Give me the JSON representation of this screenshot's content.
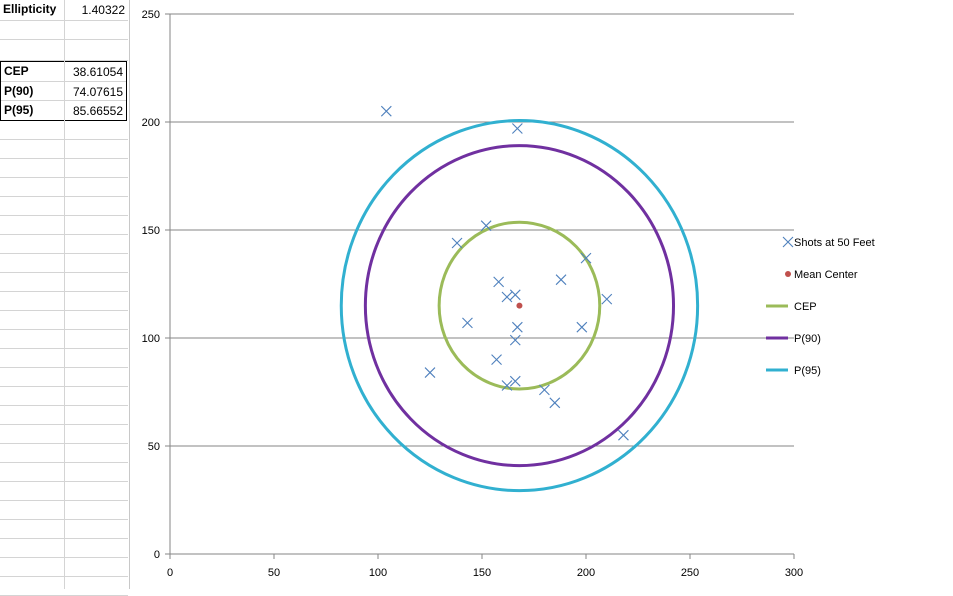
{
  "sheet": {
    "ellipticity": {
      "label": "Ellipticity",
      "value": "1.40322"
    },
    "rows": [
      {
        "label": "CEP",
        "value": "38.61054"
      },
      {
        "label": "P(90)",
        "value": "74.07615"
      },
      {
        "label": "P(95)",
        "value": "85.66552"
      }
    ]
  },
  "chart_data": {
    "type": "scatter",
    "xlim": [
      0,
      300
    ],
    "ylim": [
      0,
      250
    ],
    "x_ticks": [
      "0",
      "50",
      "100",
      "150",
      "200",
      "250",
      "300"
    ],
    "y_ticks": [
      "0",
      "50",
      "100",
      "150",
      "200",
      "250"
    ],
    "grid": "horizontal",
    "legend_position": "right",
    "series": [
      {
        "name": "Shots at 50 Feet",
        "marker": "x",
        "color": "#4f81bd",
        "points": [
          [
            104,
            205
          ],
          [
            167,
            197
          ],
          [
            152,
            152
          ],
          [
            138,
            144
          ],
          [
            200,
            137
          ],
          [
            188,
            127
          ],
          [
            158,
            126
          ],
          [
            166,
            120
          ],
          [
            162,
            119
          ],
          [
            210,
            118
          ],
          [
            143,
            107
          ],
          [
            167,
            105
          ],
          [
            198,
            105
          ],
          [
            166,
            99
          ],
          [
            157,
            90
          ],
          [
            125,
            84
          ],
          [
            166,
            80
          ],
          [
            162,
            78
          ],
          [
            180,
            76
          ],
          [
            185,
            70
          ],
          [
            218,
            55
          ]
        ]
      },
      {
        "name": "Mean Center",
        "marker": "dot",
        "color": "#c0504d",
        "points": [
          [
            168,
            115
          ]
        ]
      },
      {
        "name": "CEP",
        "type": "circle",
        "color": "#9bbb59",
        "center": [
          168,
          115
        ],
        "radius": 38.61054
      },
      {
        "name": "P(90)",
        "type": "circle",
        "color": "#7030a0",
        "center": [
          168,
          115
        ],
        "radius": 74.07615
      },
      {
        "name": "P(95)",
        "type": "circle",
        "color": "#31b0d0",
        "center": [
          168,
          115
        ],
        "radius": 85.66552
      }
    ]
  }
}
